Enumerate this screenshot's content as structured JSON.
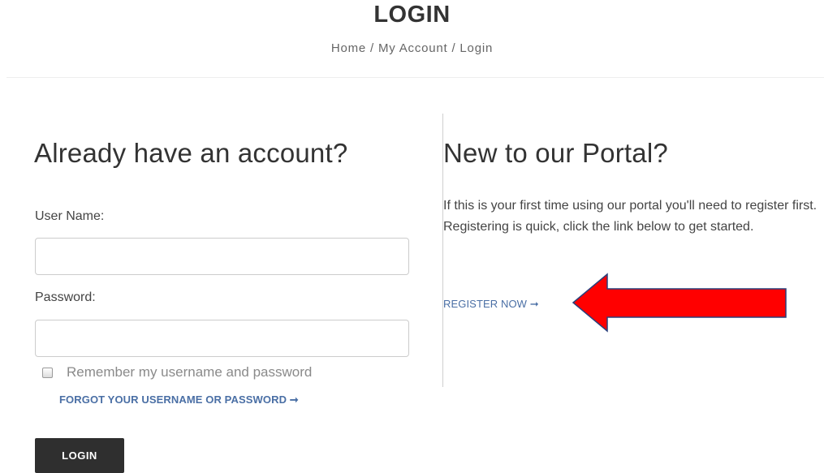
{
  "header": {
    "title": "LOGIN",
    "breadcrumb": "Home / My Account / Login"
  },
  "login_form": {
    "heading": "Already have an account?",
    "username_label": "User Name:",
    "username_value": "",
    "password_label": "Password:",
    "password_value": "",
    "remember_label": "Remember my username and password",
    "remember_checked": false,
    "forgot_link": "FORGOT YOUR USERNAME OR PASSWORD ➞",
    "submit_label": "LOGIN"
  },
  "register_panel": {
    "heading": "New to our Portal?",
    "description": "If this is your first time using our portal you'll need to register first. Registering is quick, click the link below to get started.",
    "register_link": "REGISTER NOW ➞"
  },
  "annotation": {
    "arrow_color": "#ff0000",
    "arrow_outline": "#2a3f7a",
    "arrow_direction": "left"
  },
  "colors": {
    "link": "#4a6fa5",
    "button_bg": "#2f2f2f",
    "text": "#333333"
  }
}
